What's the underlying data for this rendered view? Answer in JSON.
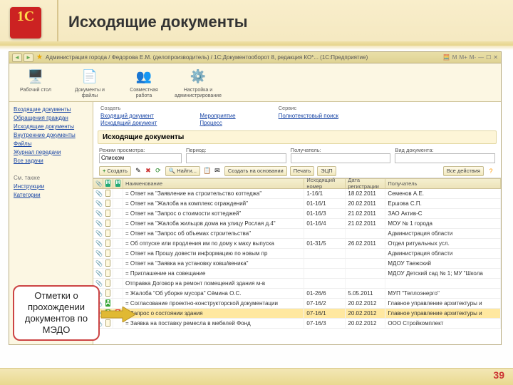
{
  "slide": {
    "title": "Исходящие документы",
    "logo_text": "1C",
    "page_number": "39",
    "callout": "Отметки о прохождении документов по МЭДО"
  },
  "titlebar": {
    "breadcrumb": "Администрация города / Федорова Е.М. (делопроизводитель) / 1С:Документооборот 8, редакция КО*... (1С:Предприятие)",
    "buffer_labels": [
      "M",
      "M+",
      "M-"
    ]
  },
  "nav_tools": [
    {
      "caption": "Рабочий стол",
      "icon": "🖥️"
    },
    {
      "caption": "Документы и файлы",
      "icon": "📄"
    },
    {
      "caption": "Совместная работа",
      "icon": "👥"
    },
    {
      "caption": "Настройка и администрирование",
      "icon": "⚙️"
    }
  ],
  "sidebar": {
    "links": [
      "Входящие документы",
      "Обращения граждан",
      "Исходящие документы",
      "Внутренние документы",
      "Файлы",
      "Журнал передачи",
      "Все задачи"
    ],
    "see_also_label": "См. также",
    "see_also": [
      "Инструкции",
      "Категории"
    ]
  },
  "create_block": {
    "headers": [
      "Создать",
      "",
      "Сервис"
    ],
    "col1": [
      "Входящий документ",
      "Исходящий документ"
    ],
    "col2": [
      "Мероприятие",
      "Процесс"
    ],
    "col3": [
      "Полнотекстовый поиск"
    ]
  },
  "panel_title": "Исходящие документы",
  "filters": {
    "mode_label": "Режим просмотра:",
    "mode_value": "Списком",
    "period_label": "Период:",
    "period_value": "",
    "recipient_label": "Получатель:",
    "recipient_value": "",
    "doctype_label": "Вид документа:",
    "doctype_value": ""
  },
  "actions": {
    "create": "Создать",
    "find": "Найти...",
    "create_on_base": "Создать на основании",
    "print": "Печать",
    "ecp": "ЭЦП",
    "all_actions": "Все действия"
  },
  "columns": {
    "name": "Наименование",
    "reg": "Исходящий номер",
    "date": "Дата регистрации",
    "rcpt": "Получатель"
  },
  "rows": [
    {
      "clip": true,
      "f1": "",
      "f2": "",
      "name": "= Ответ на \"Заявление на строительство коттеджа\"",
      "reg": "1-16/1",
      "date": "18.02.2011",
      "rcpt": "Семенов А.Е."
    },
    {
      "clip": true,
      "f1": "",
      "f2": "",
      "name": "= Ответ на \"Жалоба на комплекс ограждений\"",
      "reg": "01-16/1",
      "date": "20.02.2011",
      "rcpt": "Ершова С.П."
    },
    {
      "clip": true,
      "f1": "",
      "f2": "",
      "name": "= Ответ на \"Запрос о стоимости коттеджей\"",
      "reg": "01-16/3",
      "date": "21.02.2011",
      "rcpt": "ЗАО Актив-С",
      "lock": true
    },
    {
      "clip": true,
      "f1": "",
      "f2": "",
      "name": "= Ответ на \"Жалоба жильцов дома на улицу Рослая д.4\"",
      "reg": "01-16/4",
      "date": "21.02.2011",
      "rcpt": "МОУ № 1 города"
    },
    {
      "clip": true,
      "f1": "",
      "f2": "",
      "name": "= Ответ на \"Запрос об объемах строительства\"",
      "reg": "",
      "date": "",
      "rcpt": "Администрация области"
    },
    {
      "clip": true,
      "f1": "",
      "f2": "",
      "name": "= Об отпуске или продления им по дому к маху выпуска",
      "reg": "01-31/5",
      "date": "26.02.2011",
      "rcpt": "Отдел ритуальных усл."
    },
    {
      "clip": true,
      "f1": "",
      "f2": "",
      "name": "= Ответ на Прошу довести информацию по новым пр",
      "reg": "",
      "date": "",
      "rcpt": "Администрация области"
    },
    {
      "clip": true,
      "f1": "",
      "f2": "",
      "name": "= Ответ на \"Заявка на установку ковш/веника\"",
      "reg": "",
      "date": "",
      "rcpt": "МДОУ Таежский"
    },
    {
      "clip": true,
      "f1": "",
      "f2": "",
      "name": "= Приглашение на совещание",
      "reg": "",
      "date": "",
      "rcpt": "МДОУ Детский сад № 1; МУ \"Школа"
    },
    {
      "clip": true,
      "f1": "",
      "f2": "",
      "name": "Отправка Договор на ремонт помещений здания м-в",
      "reg": "",
      "date": "",
      "rcpt": ""
    },
    {
      "clip": true,
      "f1": "",
      "f2": "",
      "name": "= Жалоба \"Об уборке мусора\" Сёмина О.С.",
      "reg": "01-26/6",
      "date": "5.05.2011",
      "rcpt": "МУП \"Теплоэнерго\""
    },
    {
      "clip": true,
      "f1": "d",
      "f2": "",
      "name": "= Согласование проектно-конструкторской документации",
      "reg": "07-16/2",
      "date": "20.02.2012",
      "rcpt": "Главное управление архитектуры и"
    },
    {
      "clip": true,
      "f1": "d",
      "f2": "p",
      "name": "= Запрос о состоянии здания",
      "reg": "07-16/1",
      "date": "20.02.2012",
      "rcpt": "Главное управление архитектуры и",
      "sel": true
    },
    {
      "clip": true,
      "f1": "",
      "f2": "",
      "name": "= Заявка на поставку ремесла в мебелей Фонд",
      "reg": "07-16/3",
      "date": "20.02.2012",
      "rcpt": "ООО Стройкомплект"
    }
  ]
}
